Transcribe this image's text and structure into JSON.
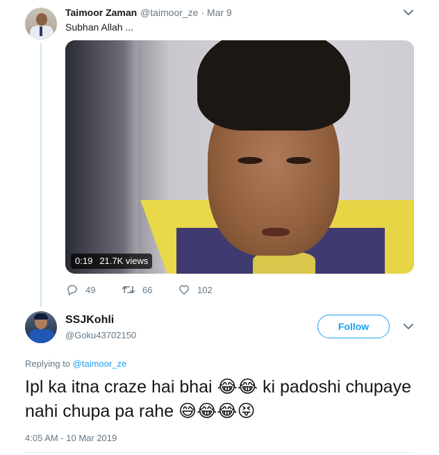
{
  "parent_tweet": {
    "name": "Taimoor Zaman",
    "handle_date": "@taimoor_ze · Mar 9",
    "text": "Subhan Allah ...",
    "video": {
      "duration": "0:19",
      "views": "21.7K views"
    },
    "actions": {
      "replies": "49",
      "retweets": "66",
      "likes": "102"
    }
  },
  "main_tweet": {
    "name": "SSJKohli",
    "handle": "@Goku43702150",
    "follow_label": "Follow",
    "replying_prefix": "Replying to",
    "replying_handle": "@taimoor_ze",
    "text_part1": "Ipl ka itna craze hai bhai",
    "text_part2": "ki padoshi chupaye nahi chupa pa rahe",
    "emojis_1": "😂😂",
    "emojis_2": "😅😂😂😝",
    "timestamp": "4:05 AM - 10 Mar 2019"
  },
  "colors": {
    "accent": "#1da1f2",
    "muted": "#657786",
    "thread_line": "#cde4f4"
  },
  "icons": [
    "reply-icon",
    "retweet-icon",
    "like-icon",
    "chevron-down-icon"
  ]
}
